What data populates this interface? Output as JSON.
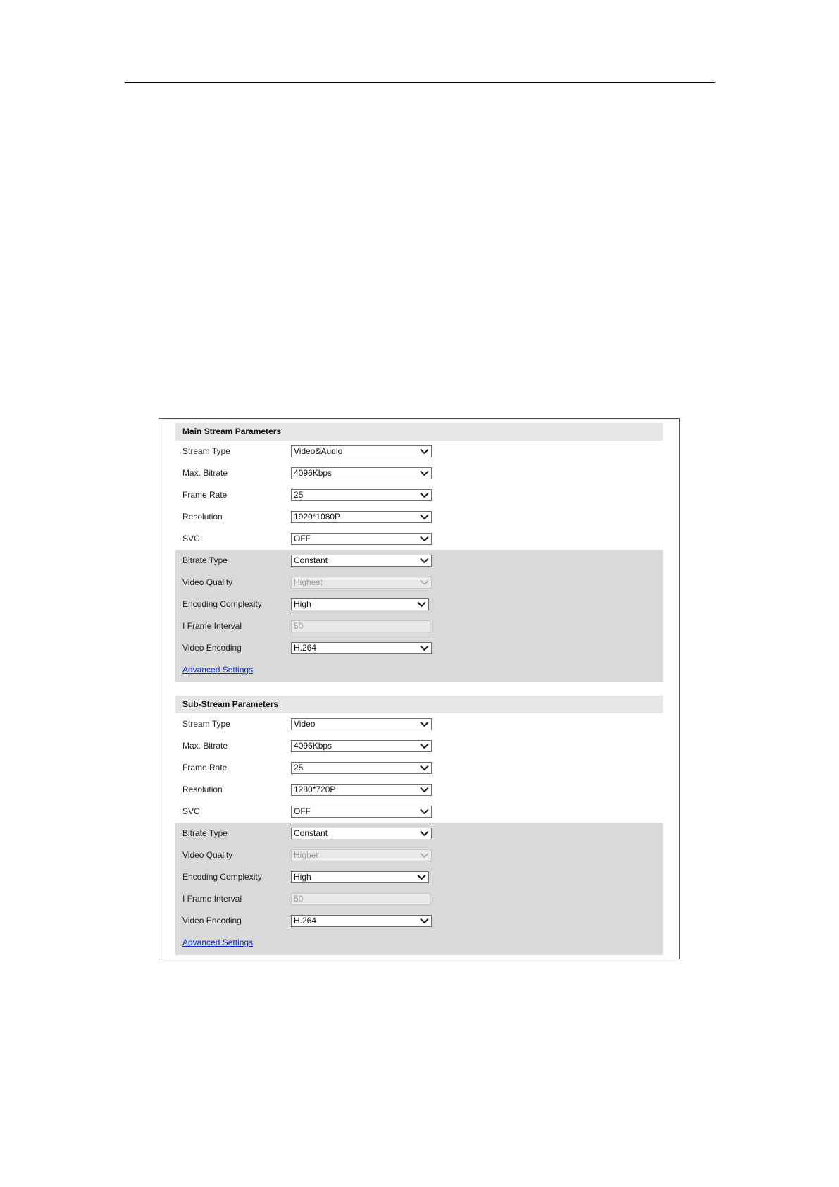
{
  "main_stream": {
    "title": "Main Stream Parameters",
    "stream_type": {
      "label": "Stream Type",
      "value": "Video&Audio"
    },
    "max_bitrate": {
      "label": "Max. Bitrate",
      "value": "4096Kbps"
    },
    "frame_rate": {
      "label": "Frame Rate",
      "value": "25"
    },
    "resolution": {
      "label": "Resolution",
      "value": "1920*1080P"
    },
    "svc": {
      "label": "SVC",
      "value": "OFF"
    },
    "bitrate_type": {
      "label": "Bitrate Type",
      "value": "Constant"
    },
    "video_quality": {
      "label": "Video Quality",
      "value": "Highest",
      "disabled": true
    },
    "encoding_complexity": {
      "label": "Encoding Complexity",
      "value": "High"
    },
    "i_frame_interval": {
      "label": "I Frame Interval",
      "value": "50",
      "disabled": true
    },
    "video_encoding": {
      "label": "Video Encoding",
      "value": "H.264"
    },
    "advanced_link": "Advanced Settings"
  },
  "sub_stream": {
    "title": "Sub-Stream Parameters",
    "stream_type": {
      "label": "Stream Type",
      "value": "Video"
    },
    "max_bitrate": {
      "label": "Max. Bitrate",
      "value": "4096Kbps"
    },
    "frame_rate": {
      "label": "Frame Rate",
      "value": "25"
    },
    "resolution": {
      "label": "Resolution",
      "value": "1280*720P"
    },
    "svc": {
      "label": "SVC",
      "value": "OFF"
    },
    "bitrate_type": {
      "label": "Bitrate Type",
      "value": "Constant"
    },
    "video_quality": {
      "label": "Video Quality",
      "value": "Higher",
      "disabled": true
    },
    "encoding_complexity": {
      "label": "Encoding Complexity",
      "value": "High"
    },
    "i_frame_interval": {
      "label": "I Frame Interval",
      "value": "50",
      "disabled": true
    },
    "video_encoding": {
      "label": "Video Encoding",
      "value": "H.264"
    },
    "advanced_link": "Advanced Settings"
  },
  "icons": {
    "dropdown": "chevron-down-icon"
  },
  "colors": {
    "link": "#0b2bd1",
    "section_header_bg": "#e6e6e6",
    "advanced_block_bg": "#d9d9d9",
    "disabled_field_bg": "#e9e9e9"
  }
}
